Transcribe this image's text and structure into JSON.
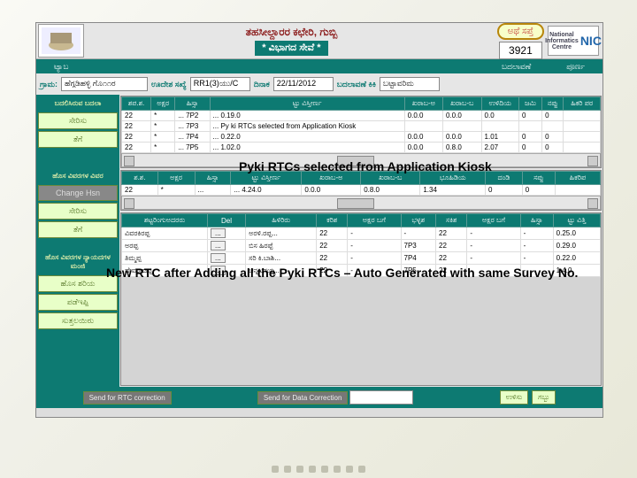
{
  "header": {
    "title_kn": "ತಹಸೀಲ್ದಾರರ ಕಛೇರಿ,   ಗುಬ್ಬಿ",
    "subtitle_kn": "* ವಿಭಾಗದ ಸೇವೆ *",
    "pill_label": "ಅಥೆ ಸಪ್ತೆ",
    "count": "3921",
    "nic_text": "National Informatics Centre NIC"
  },
  "menu": {
    "left": "ಟ್ಯಾಬ",
    "mid": "ಬದಲಾವಣೆ",
    "right": "ಪೂರ್ಣ"
  },
  "search": {
    "village_lbl": "ಗ್ರಾಮ:",
    "village_val": "ಹೆಗ್ಗಡಿಹಳ್ಳಿ ಗೊ೧೧ರ",
    "mut_lbl": "ಊದೇಶ ಸಖ್ಯೆ",
    "mut_val": "RR1(3)ಯು/C",
    "date_lbl": "ದಿನಾಕ",
    "date_val": "22/11/2012",
    "reason_lbl": "ಬದಲಾವಣೆ ಕಿಕಿ",
    "reason_val": "ಬಟ್ಟಾವರಿಮ"
  },
  "grid1": {
    "cols": [
      "ಶಪ.ಶ.",
      "ಅಕ್ಷರ",
      "ಹಿಸ್ಸಾ",
      "ಟ್ಟು ವಿಸ್ತೀರ್ಣ",
      "ಖರಾಬ-ಅ",
      "ಖರಾಬ-ಬ",
      "ಉಳಿದಿಯ",
      "ಜಮಿ",
      "ನಪ್ಪು",
      "ಹಿಕರಿ ಪರ"
    ],
    "rows": [
      [
        "22",
        "*",
        "... 7P2",
        "... 0.19.0",
        "0.0.0",
        "0.0.0",
        "0.0",
        "0",
        "0",
        ""
      ],
      [
        "22",
        "*",
        "... 7P3",
        "... Py ki  RTCs  selected  from  Application  Kiosk",
        "",
        "",
        "",
        "",
        "",
        ""
      ],
      [
        "22",
        "*",
        "... 7P4",
        "... 0.22.0",
        "0.0.0",
        "0.0.0",
        "1.01",
        "0",
        "0",
        ""
      ],
      [
        "22",
        "*",
        "... 7P5",
        "... 1.02.0",
        "0.0.0",
        "0.8.0",
        "2.07",
        "0",
        "0",
        ""
      ]
    ]
  },
  "grid2": {
    "cols": [
      "ಶ.ಶ.",
      "ಅಕ್ಷರ",
      "ಹಿಸ್ಸಾ",
      "ಟ್ಟು ವಿಸ್ತೀರ್ಣ",
      "ಖರಾಬ-ಅ",
      "ಖರಾಬ-ಬ",
      "ಭೂಹಿಡಿಯ",
      "ದಂಡಿ",
      "ಸಪ್ಪು",
      "ಹಿಕರಿಪ"
    ],
    "rows": [
      [
        "22",
        "*",
        "...",
        "... 4.24.0",
        "0.0.0",
        "0.8.0",
        "1.34",
        "0",
        "0",
        ""
      ]
    ]
  },
  "grid3": {
    "cols": [
      "ಶಟ್ಟರಿಂಗುಅದರರು",
      "Del",
      "ಹಿಳಿರಿರು",
      "ಕರಿಶ",
      "ಅಕ್ಷರ ಬಗೆ",
      "ಭಳ್ಳಶ",
      "ಸಕಿಶ",
      "ಅಕ್ಷರ ಬಗೆ",
      "ಹಿಸ್ಸಾ",
      "ಟ್ಟು ವಿತ್ತಿ"
    ],
    "rows": [
      [
        "ವಿವರಕಿರಪ್ಪ",
        "...",
        "ಅರಳಿ.ರಪ್ಪ...",
        "22",
        "-",
        "-",
        "22",
        "-",
        "-",
        "0.25.0"
      ],
      [
        "ಅರಪ್ಪ",
        "...",
        "ಬಿಸ ಹಿರಪ್ಪೆ",
        "22",
        "-",
        "7P3",
        "22",
        "-",
        "-",
        "0.29.0"
      ],
      [
        "ತಿಮ್ಮಪ್ಪ",
        "...",
        "ಸರಿ ಕಿ.ಬಾಶಿ...",
        "22",
        "-",
        "7P4",
        "22",
        "-",
        "-",
        "0.22.0"
      ],
      [
        "ದೇವರಾಜಪ್ಪ",
        "...",
        "ಚನ್ನಬಸಯ್ಯ...",
        "22",
        "-",
        "7P5",
        "22",
        "-",
        "-",
        "1.4.0"
      ]
    ]
  },
  "sidebar": {
    "head1": "ಬದಲಿಸಿರುವ ಬದಲಾ",
    "b1": "ಸೇರಿಸು",
    "b2": "ತೆಗೆ",
    "head2": "ಹೊಸ ವಿವರಗಳ ವಿವರ",
    "b3": "Change Hsn",
    "b4": "ಸೇರಿಸು",
    "b5": "ತೆಗೆ",
    "head3": "ಹೊಸ ವಿವರಗಳ ನ್ಯಾಯದಗಳ ಮಂಜಿ",
    "b6": "ಹೊಸ ಶರಿಯ",
    "b7": "ಪಡೆಇಪ್ಪಿ",
    "b8": "ಸುತ್ತಲಯಿರು"
  },
  "footer": {
    "btn1": "Send for RTC correction",
    "btn2": "Send for Data Correction",
    "btn_save": "ಉಳಿಸು",
    "btn_close": "ಗಬ್ಬು"
  },
  "callout1": "Pyki RTCs selected from Application Kiosk",
  "callout2": "New RTC after Adding all the Pyki RTCs – Auto Generated with same Survey No."
}
